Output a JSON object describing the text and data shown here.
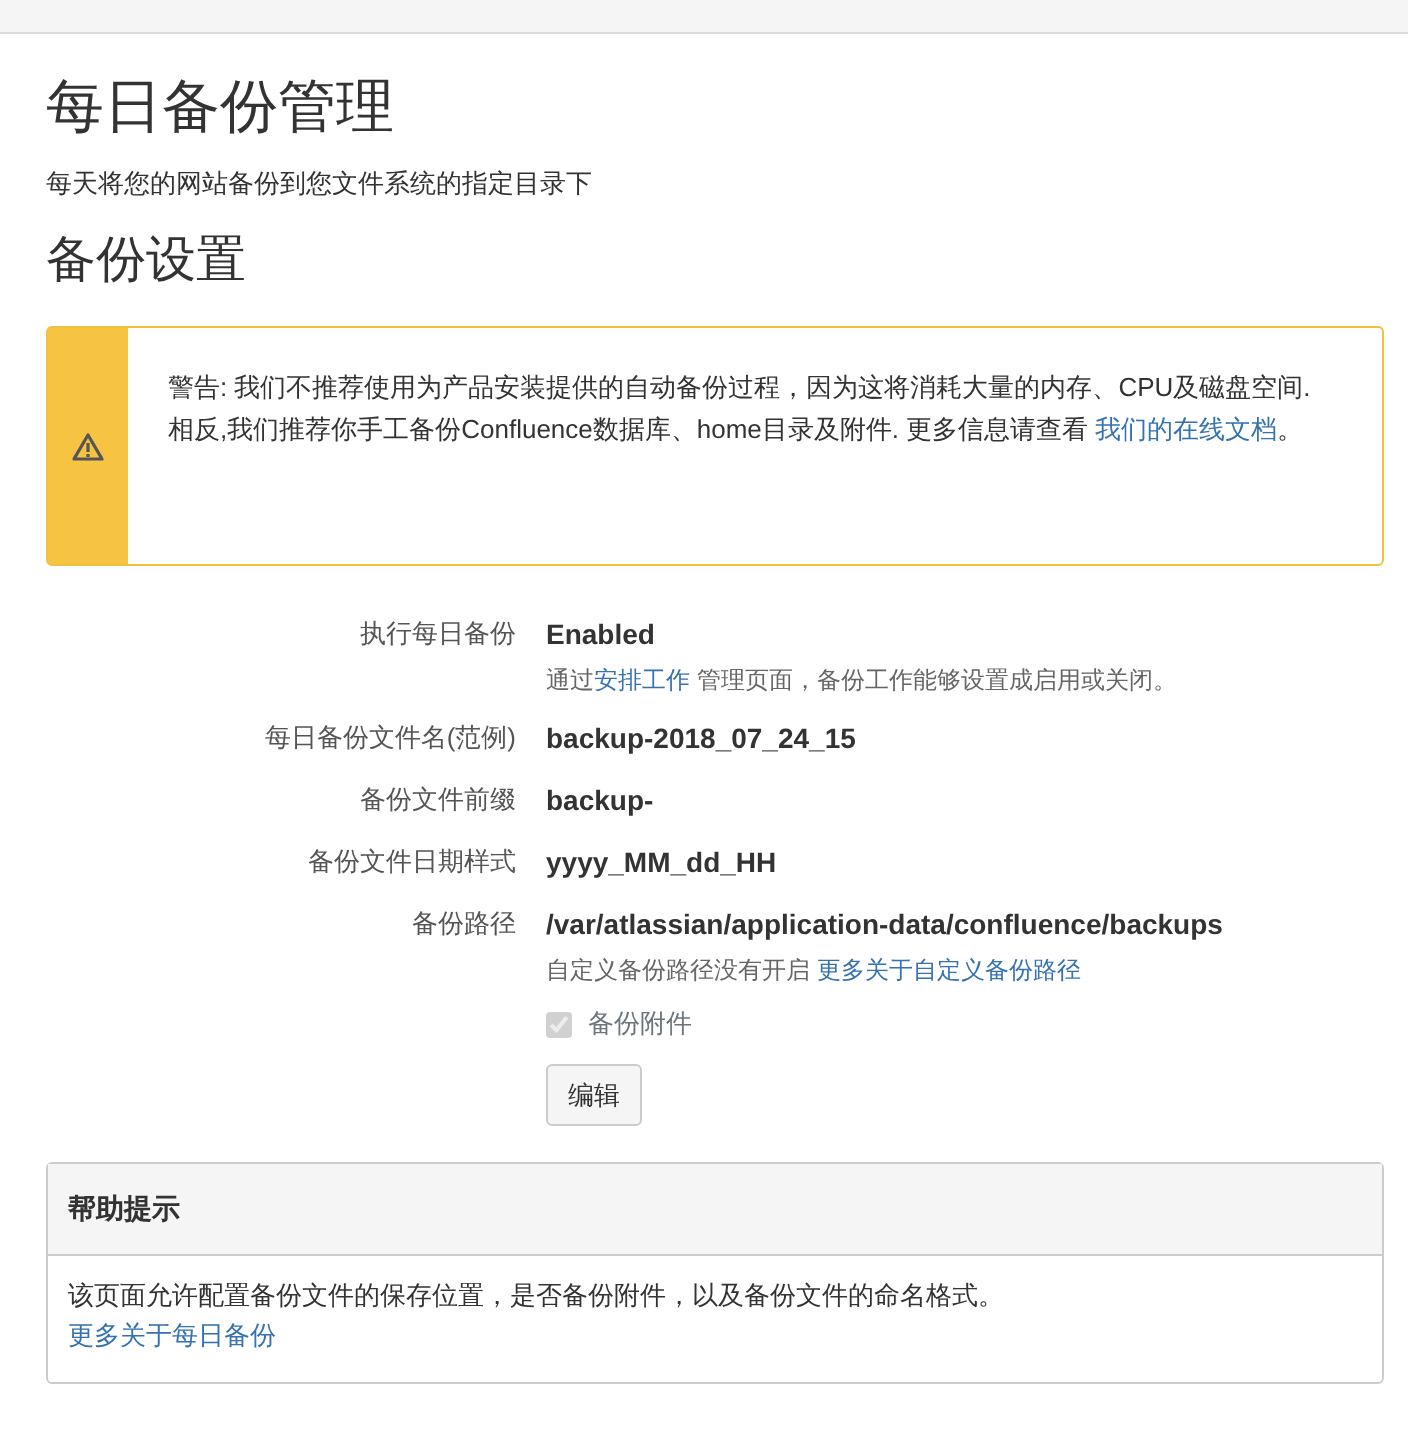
{
  "page_title": "每日备份管理",
  "page_description": "每天将您的网站备份到您文件系统的指定目录下",
  "section_title": "备份设置",
  "warning": {
    "paragraphs": [
      {
        "text": "警告: 我们不推荐使用为产品安装提供的自动备份过程，因为这将消耗大量的内存、CPU及磁盘空间."
      },
      {
        "text": "相反,我们推荐你手工备份Confluence数据库、home目录及附件. 更多信息请查看 ",
        "link": "我们的在线文档",
        "after": "。"
      }
    ]
  },
  "settings": [
    {
      "label": "执行每日备份",
      "value": "Enabled",
      "note": {
        "text": "通过",
        "link": "安排工作",
        "after": " 管理页面，备份工作能够设置成启用或关闭。"
      }
    },
    {
      "label": "每日备份文件名(范例)",
      "value": "backup-2018_07_24_15"
    },
    {
      "label": "备份文件前缀",
      "value": "backup-"
    },
    {
      "label": "备份文件日期样式",
      "value": "yyyy_MM_dd_HH"
    },
    {
      "label": "备份路径",
      "value": "/var/atlassian/application-data/confluence/backups",
      "note": {
        "text": "自定义备份路径没有开启 ",
        "link": "更多关于自定义备份路径"
      },
      "checkbox": {
        "label": "备份附件",
        "checked": true,
        "disabled": true
      }
    }
  ],
  "edit_button": "编辑",
  "help": {
    "title": "帮助提示",
    "text": "该页面允许配置备份文件的保存位置，是否备份附件，以及备份文件的命名格式。",
    "link": "更多关于每日备份"
  }
}
